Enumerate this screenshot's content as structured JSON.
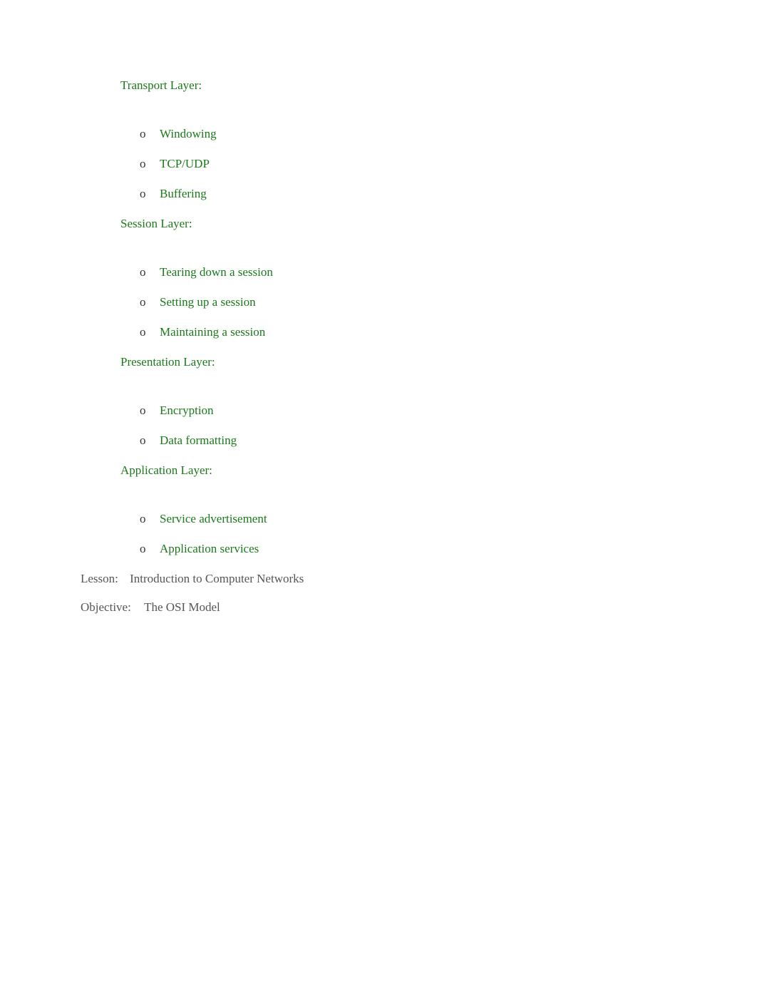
{
  "layers": [
    {
      "title": "Transport Layer:",
      "items": [
        "Windowing",
        "TCP/UDP",
        "Buffering"
      ]
    },
    {
      "title": "Session Layer:",
      "items": [
        "Tearing down a session",
        "Setting up a session",
        "Maintaining a session"
      ]
    },
    {
      "title": "Presentation Layer:",
      "items": [
        "Encryption",
        "Data formatting"
      ]
    },
    {
      "title": "Application Layer:",
      "items": [
        "Service advertisement",
        "Application services"
      ]
    }
  ],
  "lesson": {
    "label": "Lesson:",
    "value": "Introduction to Computer Networks"
  },
  "objective": {
    "label": "Objective:",
    "value": "The OSI Model"
  },
  "bullets": {
    "outer": "",
    "inner": "o"
  }
}
